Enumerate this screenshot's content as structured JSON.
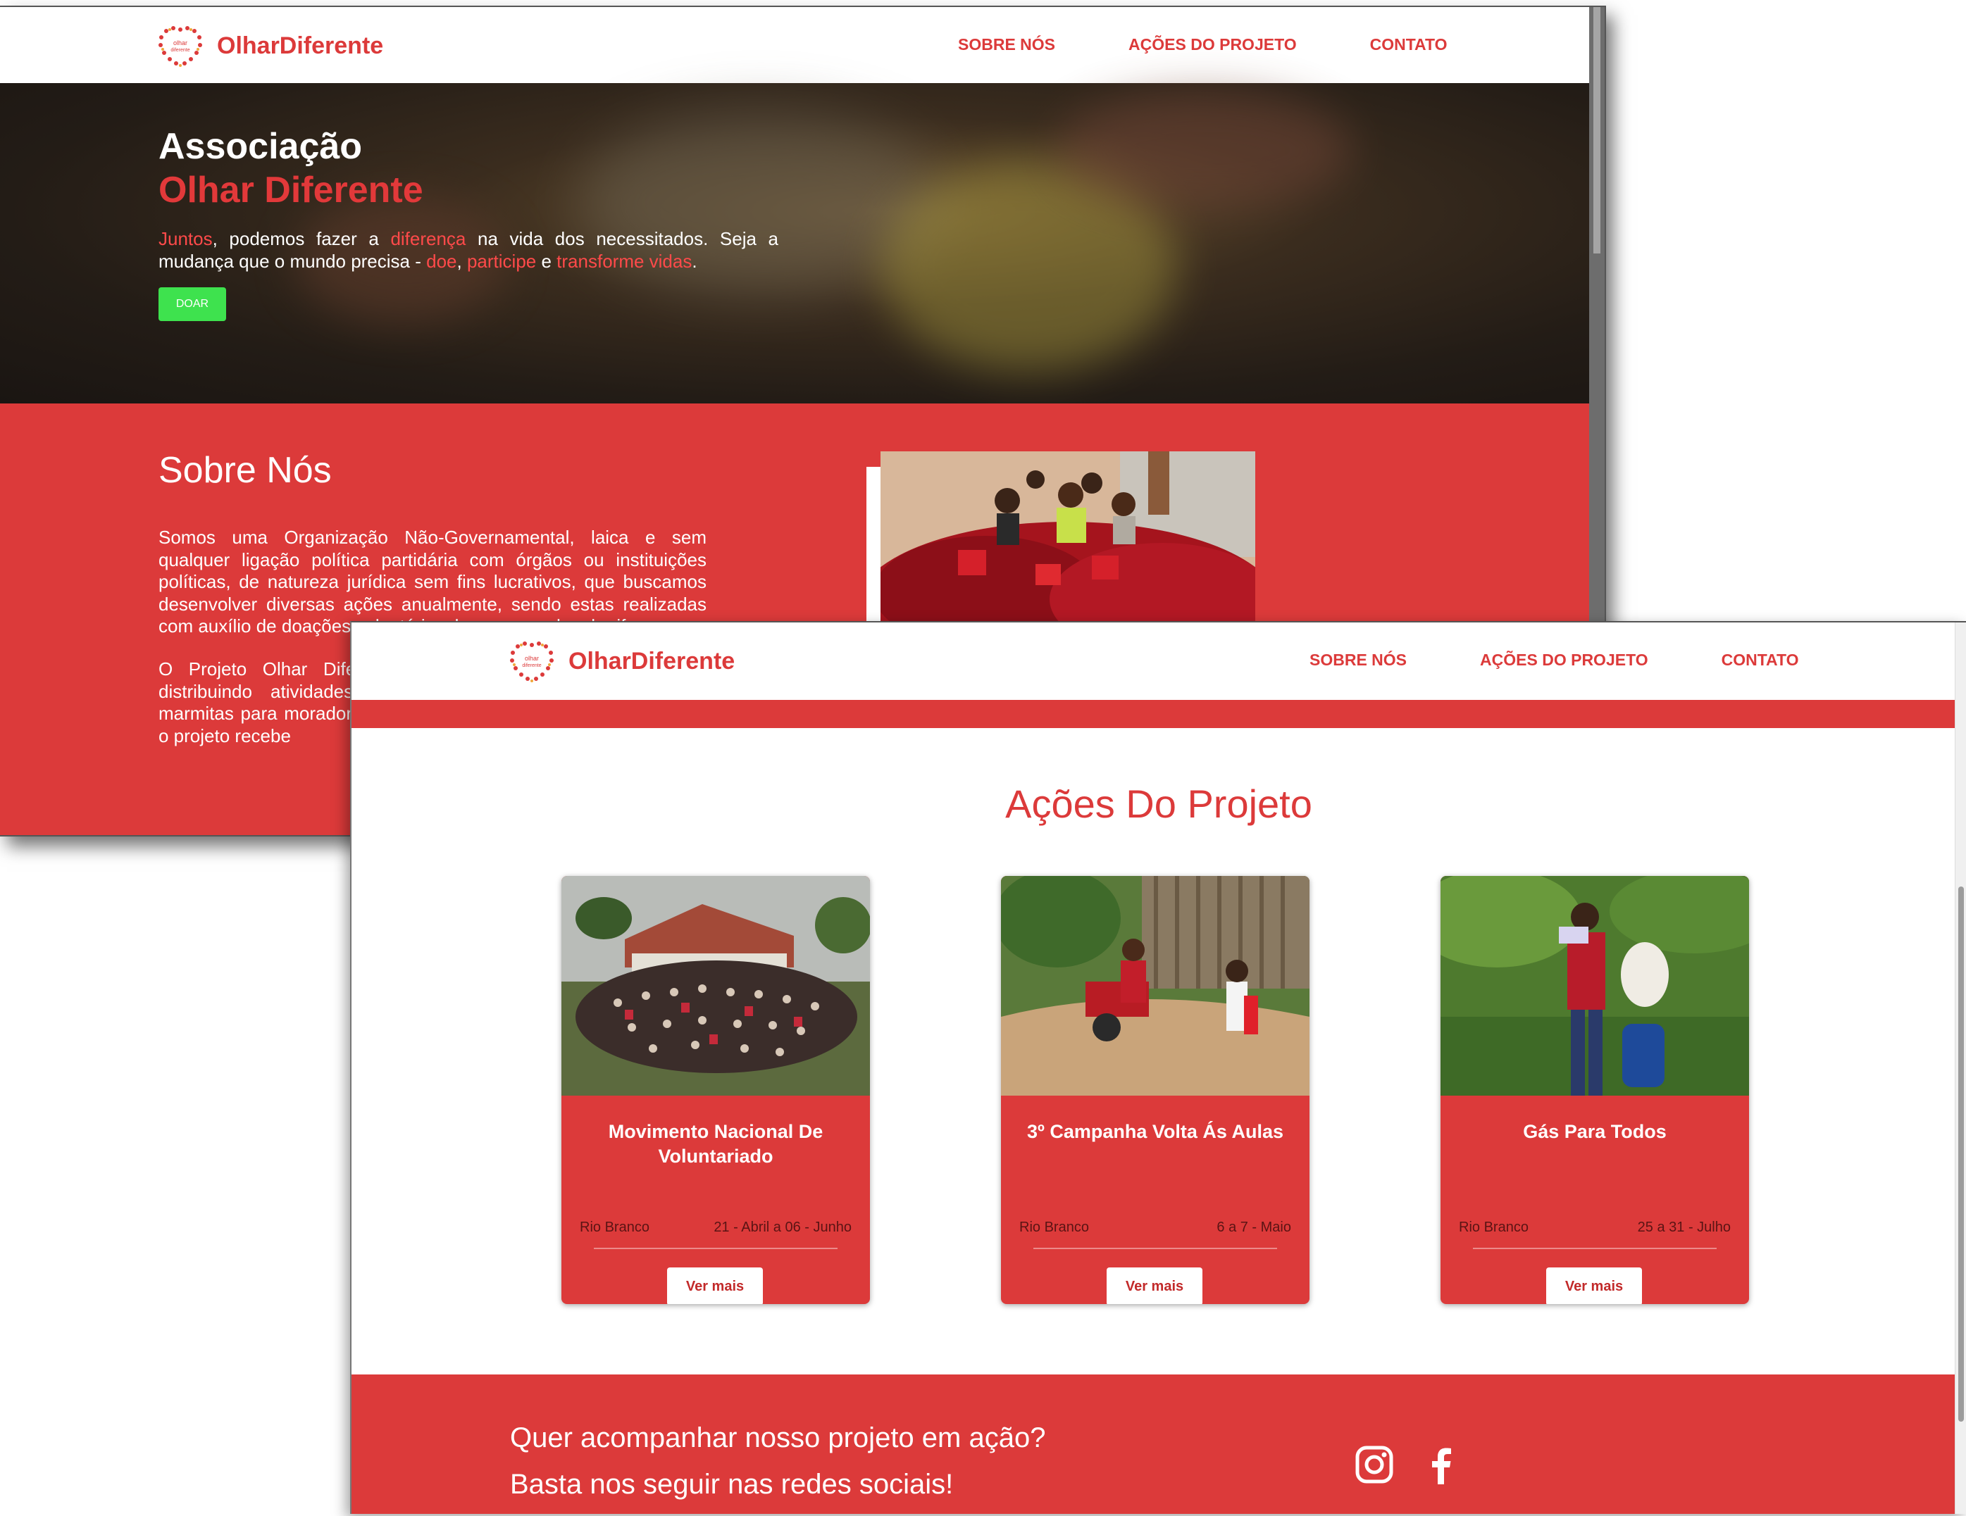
{
  "brand": {
    "name": "OlharDiferente"
  },
  "nav": {
    "items": [
      "SOBRE NÓS",
      "AÇÕES DO PROJETO",
      "CONTATO"
    ]
  },
  "hero": {
    "title_line1": "Associação",
    "title_line2": "Olhar Diferente",
    "text_segments": [
      {
        "t": "Juntos",
        "hl": true
      },
      {
        "t": ", podemos fazer a ",
        "hl": false
      },
      {
        "t": "diferença",
        "hl": true
      },
      {
        "t": " na vida dos necessitados. Seja a mudança que o mundo precisa - ",
        "hl": false
      },
      {
        "t": "doe",
        "hl": true
      },
      {
        "t": ", ",
        "hl": false
      },
      {
        "t": "participe",
        "hl": true
      },
      {
        "t": " e ",
        "hl": false
      },
      {
        "t": "transforme vidas",
        "hl": true
      },
      {
        "t": ".",
        "hl": false
      }
    ],
    "button_label": "DOAR"
  },
  "about": {
    "title": "Sobre Nós",
    "paragraph1": "Somos uma Organização Não-Governamental, laica e sem qualquer ligação política partidária com órgãos ou instituições políticas, de natureza jurídica sem fins lucrativos, que buscamos desenvolver diversas ações anualmente, sendo estas realizadas com auxílio de doações voluntárias, bazar e vendas de rifas.",
    "paragraph2": "O Projeto Olhar Diferente amigas realizaram um carentes, distribuindo atividades recreativas evento inicial, o projeto marmitas para moradores crianças em extrema pobreza. Karoliny, o projeto recebe"
  },
  "actions": {
    "title": "Ações Do Projeto",
    "cards": [
      {
        "title": "Movimento Nacional De Voluntariado",
        "location": "Rio Branco",
        "date": "21 - Abril a 06 - Junho",
        "button": "Ver mais"
      },
      {
        "title": "3º Campanha Volta Ás Aulas",
        "location": "Rio Branco",
        "date": "6 a 7 - Maio",
        "button": "Ver mais"
      },
      {
        "title": "Gás Para Todos",
        "location": "Rio Branco",
        "date": "25 a 31 - Julho",
        "button": "Ver mais"
      }
    ]
  },
  "footer": {
    "line1": "Quer acompanhar nosso projeto em ação?",
    "line2": "Basta nos seguir nas redes sociais!",
    "icons": [
      "instagram-icon",
      "facebook-icon"
    ]
  },
  "colors": {
    "brand_red": "#dc3a3a",
    "donate_green": "#3ee24e",
    "highlight_red": "#ff4a4a"
  }
}
